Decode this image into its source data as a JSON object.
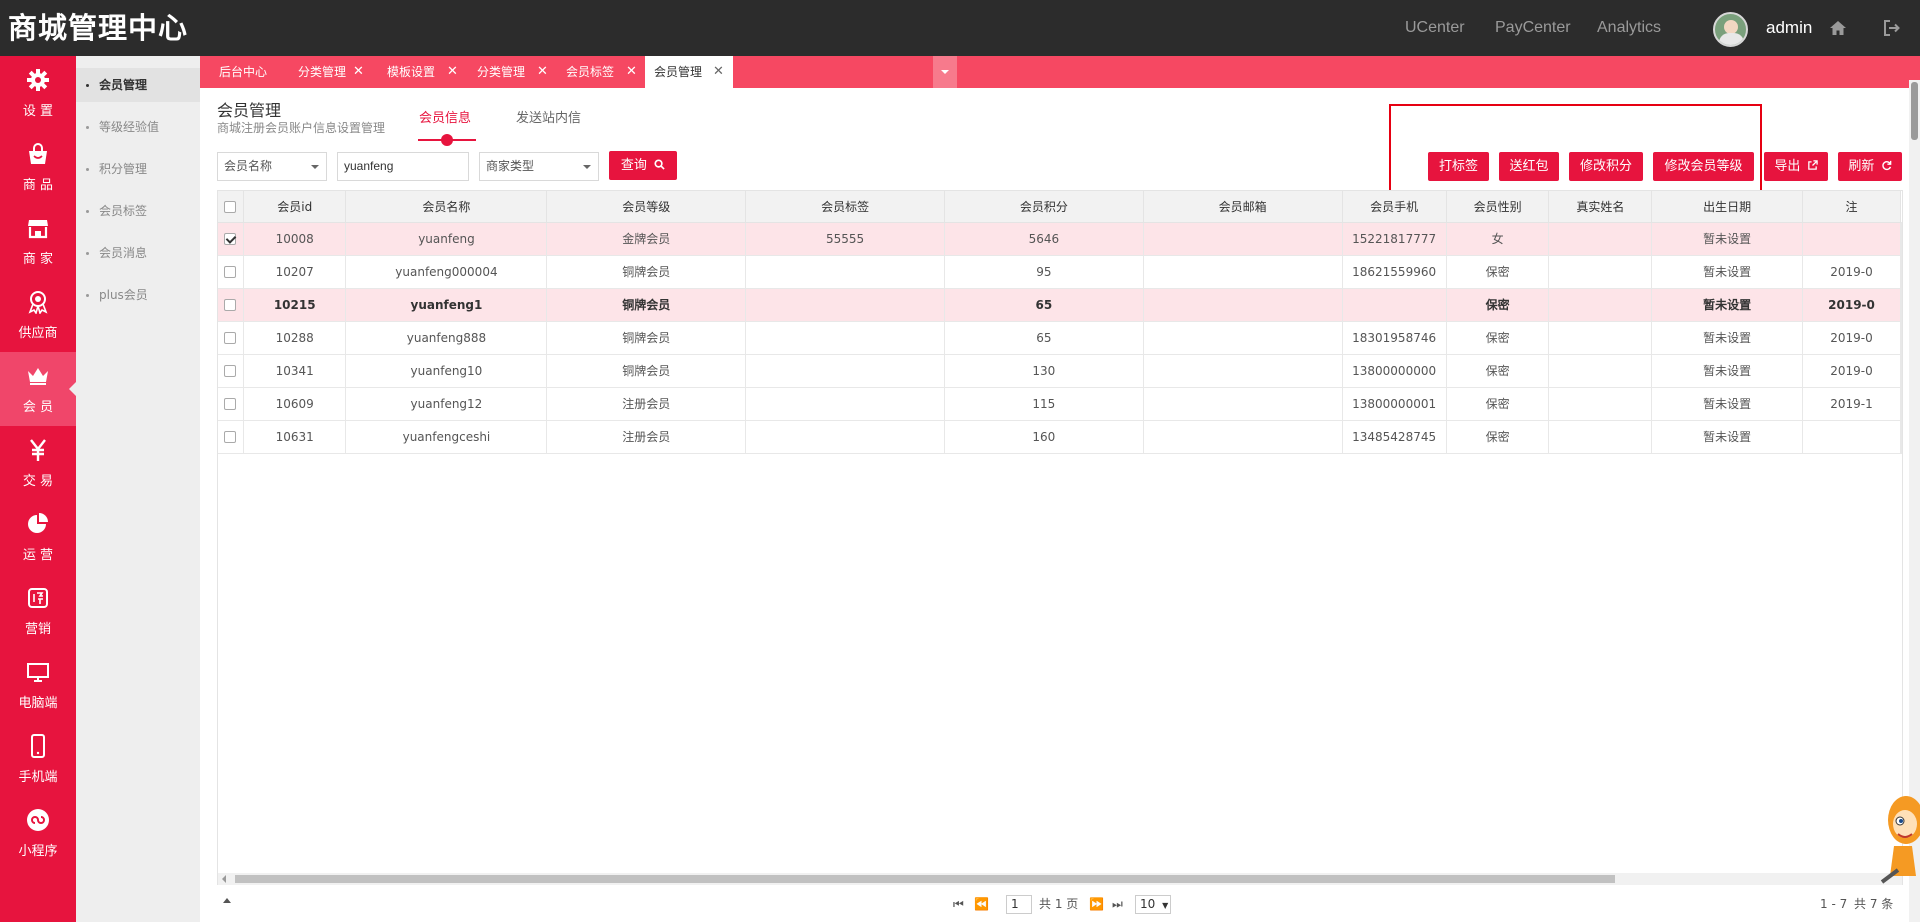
{
  "app": {
    "brand": "商城管理中心",
    "nav": [
      "UCenter",
      "PayCenter",
      "Analytics"
    ],
    "username": "admin"
  },
  "sidebar": {
    "items": [
      {
        "label": "设 置",
        "icon": "gear-icon"
      },
      {
        "label": "商 品",
        "icon": "shopping-bag-icon"
      },
      {
        "label": "商 家",
        "icon": "store-icon"
      },
      {
        "label": "供应商",
        "icon": "award-icon"
      },
      {
        "label": "会 员",
        "icon": "crown-icon"
      },
      {
        "label": "交 易",
        "icon": "yen-icon"
      },
      {
        "label": "运 营",
        "icon": "pie-chart-icon"
      },
      {
        "label": "营销",
        "icon": "promo-icon"
      },
      {
        "label": "电脑端",
        "icon": "monitor-icon"
      },
      {
        "label": "手机端",
        "icon": "mobile-icon"
      },
      {
        "label": "小程序",
        "icon": "mini-program-icon"
      }
    ]
  },
  "subnav": {
    "items": [
      "会员管理",
      "等级经验值",
      "积分管理",
      "会员标签",
      "会员消息",
      "plus会员"
    ]
  },
  "tabs": [
    {
      "label": "后台中心"
    },
    {
      "label": "分类管理"
    },
    {
      "label": "模板设置"
    },
    {
      "label": "分类管理"
    },
    {
      "label": "会员标签"
    },
    {
      "label": "会员管理"
    }
  ],
  "page": {
    "title": "会员管理",
    "subtitle": "商城注册会员账户信息设置管理",
    "tabs": [
      "会员信息",
      "发送站内信"
    ]
  },
  "filters": {
    "field_select": "会员名称",
    "keyword": "yuanfeng",
    "type_select": "商家类型",
    "query_label": "查询"
  },
  "actions": {
    "tag": "打标签",
    "red_packet": "送红包",
    "edit_points": "修改积分",
    "edit_level": "修改会员等级",
    "export": "导出",
    "refresh": "刷新"
  },
  "table": {
    "columns": [
      "会员id",
      "会员名称",
      "会员等级",
      "会员标签",
      "会员积分",
      "会员邮箱",
      "会员手机",
      "会员性别",
      "真实姓名",
      "出生日期",
      "注"
    ],
    "rows": [
      {
        "checked": true,
        "cells": [
          "10008",
          "yuanfeng",
          "金牌会员",
          "55555",
          "5646",
          "",
          "15221817777",
          "女",
          "",
          "暂未设置",
          ""
        ]
      },
      {
        "checked": false,
        "cells": [
          "10207",
          "yuanfeng000004",
          "铜牌会员",
          "",
          "95",
          "",
          "18621559960",
          "保密",
          "",
          "暂未设置",
          "2019-0"
        ]
      },
      {
        "checked": false,
        "cells": [
          "10215",
          "yuanfeng1",
          "铜牌会员",
          "",
          "65",
          "",
          "",
          "保密",
          "",
          "暂未设置",
          "2019-0"
        ]
      },
      {
        "checked": false,
        "cells": [
          "10288",
          "yuanfeng888",
          "铜牌会员",
          "",
          "65",
          "",
          "18301958746",
          "保密",
          "",
          "暂未设置",
          "2019-0"
        ]
      },
      {
        "checked": false,
        "cells": [
          "10341",
          "yuanfeng10",
          "铜牌会员",
          "",
          "130",
          "",
          "13800000000",
          "保密",
          "",
          "暂未设置",
          "2019-0"
        ]
      },
      {
        "checked": false,
        "cells": [
          "10609",
          "yuanfeng12",
          "注册会员",
          "",
          "115",
          "",
          "13800000001",
          "保密",
          "",
          "暂未设置",
          "2019-1"
        ]
      },
      {
        "checked": false,
        "cells": [
          "10631",
          "yuanfengceshi",
          "注册会员",
          "",
          "160",
          "",
          "13485428745",
          "保密",
          "",
          "暂未设置",
          ""
        ]
      }
    ]
  },
  "pager": {
    "current": "1",
    "total_pages": "共 1 页",
    "page_size": "10",
    "range": "1 - 7",
    "total": "共 7 条"
  },
  "colors": {
    "accent": "#e7143e",
    "tab_strip": "#f64862",
    "topbar": "#2c2c2c"
  }
}
